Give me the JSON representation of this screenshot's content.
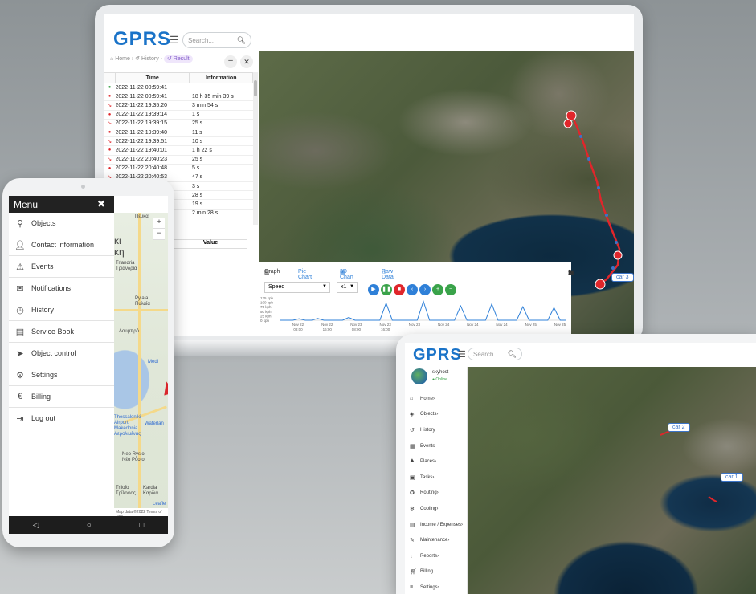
{
  "brand": {
    "logo_text": "GPRS",
    "accent": "#1a73c8"
  },
  "laptop": {
    "search_placeholder": "Search...",
    "breadcrumb": {
      "home": "Home",
      "history": "History",
      "result": "Result"
    },
    "table": {
      "headers": [
        "Time",
        "Information"
      ],
      "rows": [
        {
          "icon": "parking-icon",
          "time": "2022-11-22 00:59:41",
          "info": ""
        },
        {
          "icon": "stop-icon",
          "time": "2022-11-22 00:59:41",
          "info": "18 h 35 min 39 s"
        },
        {
          "icon": "route-icon",
          "time": "2022-11-22 19:35:20",
          "info": "3 min 54 s"
        },
        {
          "icon": "stop-icon",
          "time": "2022-11-22 19:39:14",
          "info": "1 s"
        },
        {
          "icon": "route-icon",
          "time": "2022-11-22 19:39:15",
          "info": "25 s"
        },
        {
          "icon": "stop-icon",
          "time": "2022-11-22 19:39:40",
          "info": "11 s"
        },
        {
          "icon": "route-icon",
          "time": "2022-11-22 19:39:51",
          "info": "10 s"
        },
        {
          "icon": "stop-icon",
          "time": "2022-11-22 19:40:01",
          "info": "1 h 22 s"
        },
        {
          "icon": "route-icon",
          "time": "2022-11-22 20:40:23",
          "info": "25 s"
        },
        {
          "icon": "stop-icon",
          "time": "2022-11-22 20:40:48",
          "info": "5 s"
        },
        {
          "icon": "route-icon",
          "time": "2022-11-22 20:40:53",
          "info": "47 s"
        },
        {
          "icon": "",
          "time": "",
          "info": "3 s"
        },
        {
          "icon": "",
          "time": "",
          "info": "28 s"
        },
        {
          "icon": "",
          "time": "",
          "info": "19 s"
        },
        {
          "icon": "",
          "time": "",
          "info": "2 min 28 s"
        }
      ],
      "value_header": "Value"
    },
    "graph": {
      "tabs": [
        "Graph",
        "Pie Chart",
        "3D Chart",
        "Raw Data"
      ],
      "metric": "Speed",
      "speed_multiplier": "x1"
    },
    "car_label": "car 3"
  },
  "chart_data": {
    "type": "line",
    "title": "",
    "xlabel": "",
    "ylabel": "",
    "yticks": [
      "125 kph",
      "100 kph",
      "75 kph",
      "50 kph",
      "25 kph",
      "0 kph"
    ],
    "ylim": [
      0,
      125
    ],
    "x_ticks": [
      [
        "Nov 22",
        "08:00"
      ],
      [
        "Nov 22",
        "16:00"
      ],
      [
        "Nov 23",
        "08:00"
      ],
      [
        "Nov 23",
        "16:00"
      ],
      [
        "Nov 23",
        ""
      ],
      [
        "Nov 24",
        ""
      ],
      [
        "Nov 24",
        ""
      ],
      [
        "Nov 24",
        ""
      ],
      [
        "Nov 25",
        ""
      ],
      [
        "Nov 25",
        ""
      ]
    ],
    "series": [
      {
        "values": [
          0,
          0,
          0,
          8,
          0,
          0,
          10,
          0,
          0,
          0,
          0,
          15,
          0,
          0,
          0,
          0,
          0,
          95,
          0,
          0,
          0,
          0,
          0,
          105,
          0,
          0,
          0,
          0,
          0,
          80,
          0,
          0,
          0,
          0,
          90,
          0,
          0,
          0,
          0,
          75,
          0,
          0,
          0,
          0,
          70,
          0,
          0
        ]
      }
    ]
  },
  "phone": {
    "menu_title": "Menu",
    "items": [
      {
        "icon": "location-pin-icon",
        "label": "Objects"
      },
      {
        "icon": "person-icon",
        "label": "Contact information"
      },
      {
        "icon": "warning-icon",
        "label": "Events"
      },
      {
        "icon": "envelope-icon",
        "label": "Notifications"
      },
      {
        "icon": "clock-icon",
        "label": "History"
      },
      {
        "icon": "book-icon",
        "label": "Service Book"
      },
      {
        "icon": "send-icon",
        "label": "Object control"
      },
      {
        "icon": "gear-icon",
        "label": "Settings"
      },
      {
        "icon": "euro-icon",
        "label": "Billing"
      },
      {
        "icon": "logout-icon",
        "label": "Log out"
      }
    ],
    "map_labels": [
      "Πεύκα",
      "κι",
      "κη",
      "Triandria",
      "Τριανδρία",
      "Pylaia",
      "Πυλαία",
      "Λουμπρό",
      "Medi",
      "Thessaloniki",
      "Airport",
      "Makedonia",
      "Αερολιμένας",
      "Waterlan",
      "Neo Rysio",
      "Νέο Ρύσιο",
      "Trilofo",
      "Τρίλοφος",
      "Kardia",
      "Καρδιά",
      "Leafle"
    ],
    "map_footer": "Map data ©2022   Terms of Use"
  },
  "tablet": {
    "search_placeholder": "Search...",
    "user": {
      "name": "skyhost",
      "status": "Online"
    },
    "nav": [
      {
        "icon": "home-icon",
        "label": "Home"
      },
      {
        "icon": "objects-icon",
        "label": "Objects"
      },
      {
        "icon": "history-icon",
        "label": "History"
      },
      {
        "icon": "calendar-icon",
        "label": "Events"
      },
      {
        "icon": "places-icon",
        "label": "Places"
      },
      {
        "icon": "tasks-icon",
        "label": "Tasks"
      },
      {
        "icon": "routing-icon",
        "label": "Routing"
      },
      {
        "icon": "cooling-icon",
        "label": "Cooling"
      },
      {
        "icon": "money-icon",
        "label": "Income / Expenses"
      },
      {
        "icon": "wrench-icon",
        "label": "Maintenance"
      },
      {
        "icon": "chart-icon",
        "label": "Reports"
      },
      {
        "icon": "cart-icon",
        "label": "Billing"
      },
      {
        "icon": "settings-icon",
        "label": "Settings"
      }
    ],
    "car_labels": [
      "car 2",
      "car 1"
    ]
  }
}
